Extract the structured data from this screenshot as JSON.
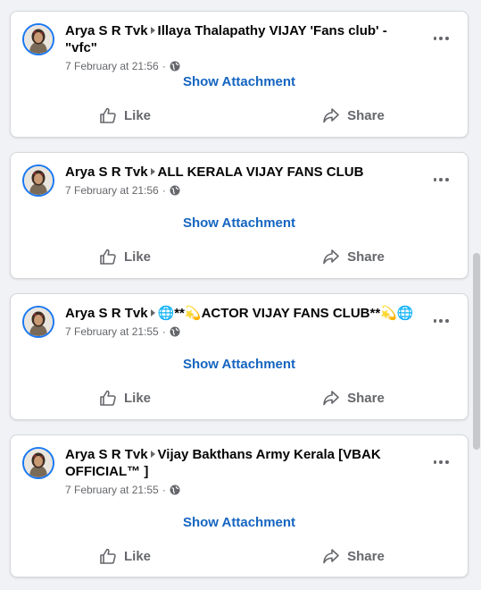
{
  "colors": {
    "link": "#1565c0",
    "avatar_ring": "#1877f2",
    "muted": "#65676b"
  },
  "icons": {
    "like": "thumbs-up-icon",
    "share": "share-arrow-icon",
    "audience": "globe-icon",
    "more": "more-dots-icon"
  },
  "posts": [
    {
      "author": "Arya S R Tvk",
      "group": "Illaya Thalapathy VIJAY 'Fans club' - \"vfc\"",
      "group_line2": "",
      "time": "7 February at 21:56",
      "separator": "·",
      "attachment_label": "Show Attachment",
      "like_label": "Like",
      "share_label": "Share"
    },
    {
      "author": "Arya S R Tvk",
      "group": "ALL KERALA VIJAY FANS CLUB",
      "group_line2": "",
      "time": "7 February at 21:56",
      "separator": "·",
      "attachment_label": "Show Attachment",
      "like_label": "Like",
      "share_label": "Share"
    },
    {
      "author": "Arya S R Tvk",
      "group": "🌐**💫ACTOR VIJAY FANS CLUB**💫🌐",
      "group_line2": "",
      "time": "7 February at 21:55",
      "separator": "·",
      "attachment_label": "Show Attachment",
      "like_label": "Like",
      "share_label": "Share"
    },
    {
      "author": "Arya S R Tvk",
      "group": "Vijay Bakthans Army Kerala [VBAK",
      "group_line2": "OFFICIAL™ ]",
      "time": "7 February at 21:55",
      "separator": "·",
      "attachment_label": "Show Attachment",
      "like_label": "Like",
      "share_label": "Share"
    }
  ]
}
